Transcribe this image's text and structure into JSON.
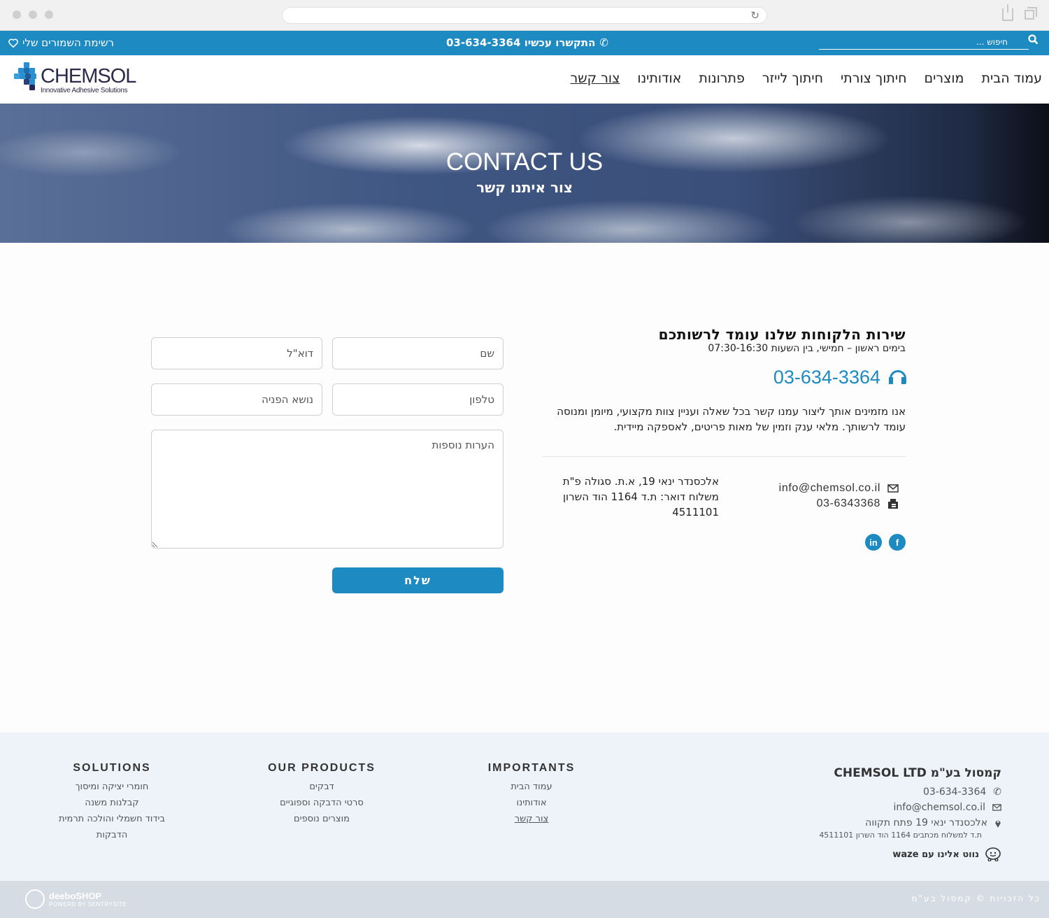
{
  "topbar": {
    "wishlist": "רשימת השמורים שלי",
    "phone_cta": "התקשרו עכשיו 03-634-3364",
    "search_placeholder": "חיפוש ..."
  },
  "logo": {
    "name": "CHEMSOL",
    "tagline": "Innovative Adhesive Solutions"
  },
  "nav": [
    "עמוד הבית",
    "מוצרים",
    "חיתוך צורתי",
    "חיתוך לייזר",
    "פתרונות",
    "אודותינו",
    "צור קשר"
  ],
  "hero": {
    "title": "CONTACT US",
    "subtitle": "צור איתנו קשר"
  },
  "info": {
    "heading": "שירות הלקוחות שלנו עומד לרשותכם",
    "hours": "בימים ראשון – חמישי, בין השעות 07:30-16:30",
    "phone": "03-634-3364",
    "desc": "אנו מזמינים אותך ליצור עמנו קשר בכל שאלה ועניין צוות מקצועי, מיומן ומנוסה עומד לרשותך. מלאי ענק וזמין של מאות פריטים, לאספקה מיידית.",
    "email": "info@chemsol.co.il",
    "fax": "03-6343368",
    "address": "אלכסנדר ינאי 19, א.ת. סגולה פ\"ת משלוח דואר: ת.ד 1164 הוד השרון 4511101",
    "linkedin": "in",
    "facebook": "f"
  },
  "form": {
    "name": "שם",
    "email": "דוא\"ל",
    "phone": "טלפון",
    "subject": "נושא הפניה",
    "notes": "הערות נוספות",
    "send": "שלח"
  },
  "footer": {
    "company": {
      "title": "קמסול בע\"מ CHEMSOL LTD",
      "phone": "03-634-3364",
      "email": "info@chemsol.co.il",
      "address": "אלכסנדר ינאי 19 פתח תקווה",
      "po_box": "ת.ד למשלוח מכתבים 1164 הוד השרון 4511101",
      "waze": "נווט אלינו עם waze"
    },
    "importants": {
      "title": "IMPORTANTS",
      "items": [
        "עמוד הבית",
        "אודותינו",
        "צור קשר"
      ]
    },
    "products": {
      "title": "OUR PRODUCTS",
      "items": [
        "דבקים",
        "סרטי הדבקה וספוגיים",
        "מוצרים נוספים"
      ]
    },
    "solutions": {
      "title": "SOLUTIONS",
      "items": [
        "חומרי יציקה ומיסוך",
        "קבלנות משנה",
        "בידוד חשמלי והולכה תרמית",
        "הדבקות"
      ]
    },
    "copyright": "כל הזכויות © קמסול בע\"מ",
    "deebo_name": "deeboSHOP",
    "deebo_sub": "POWERD BY SENTRYSITE"
  },
  "colors": {
    "accent": "#1d8ac2",
    "footer_bg": "#eef3f9",
    "bottom_bar": "#d6dce3"
  }
}
